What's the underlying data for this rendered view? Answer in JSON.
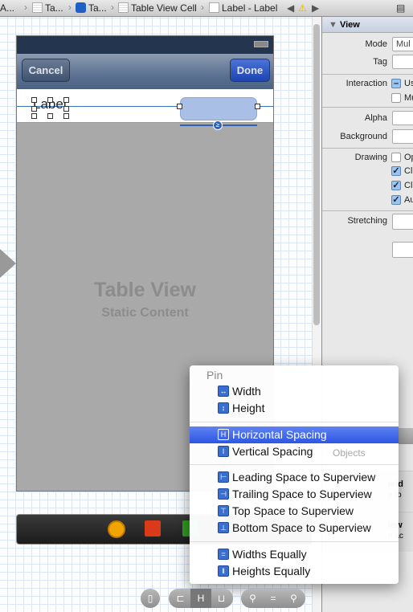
{
  "breadcrumb": {
    "items": [
      "A...",
      "Ta...",
      "Ta...",
      "Table View Cell",
      "Label - Label"
    ],
    "warning_icon": "warning-icon"
  },
  "scene": {
    "cancel": "Cancel",
    "done": "Done",
    "label": "Label",
    "table_view": "Table View",
    "static_content": "Static Content"
  },
  "inspector": {
    "section": "View",
    "mode_label": "Mode",
    "mode_value": "Mul",
    "tag_label": "Tag",
    "interaction_label": "Interaction",
    "interaction_opt1": "Us",
    "interaction_opt2": "Mu",
    "alpha_label": "Alpha",
    "background_label": "Background",
    "drawing_label": "Drawing",
    "drawing_opt1": "Op",
    "drawing_opt2": "Cl",
    "drawing_opt3": "Cl",
    "drawing_opt4": "Au",
    "stretching_label": "Stretching"
  },
  "library": {
    "segment": "Objects",
    "item1_title": "ield",
    "item1_desc": "e to",
    "item2_title": "iew",
    "item2_desc": "n ac"
  },
  "menu": {
    "header": "Pin",
    "items": [
      "Width",
      "Height",
      "Horizontal Spacing",
      "Vertical Spacing",
      "Leading Space to Superview",
      "Trailing Space to Superview",
      "Top Space to Superview",
      "Bottom Space to Superview",
      "Widths Equally",
      "Heights Equally"
    ],
    "highlighted": "Horizontal Spacing"
  },
  "colors": {
    "highlight": "#2d57e4",
    "navbar": "#5c7292"
  }
}
